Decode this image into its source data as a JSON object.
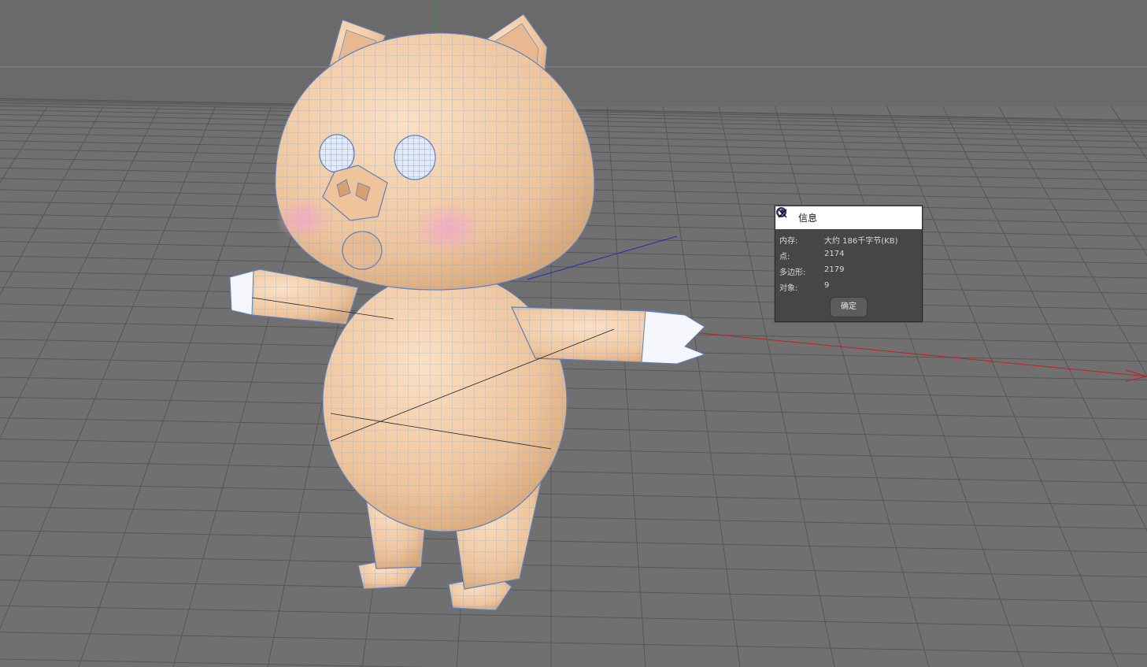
{
  "dialog": {
    "title": "信息",
    "rows": [
      {
        "label": "内存:",
        "value": "大约 186千字节(KB)"
      },
      {
        "label": "点:",
        "value": "2174"
      },
      {
        "label": "多边形:",
        "value": "2179"
      },
      {
        "label": "对象:",
        "value": "9"
      }
    ],
    "ok_label": "确定"
  },
  "scene": {
    "background_color": "#6e6e6e",
    "grid_color": "#4a4a4a",
    "model_color": "#f0c8a0",
    "wire_color": "#7d9fd0",
    "axis_x_color": "#c02020",
    "axis_y_color": "#20a040",
    "axis_z_color": "#2030b0"
  },
  "icons": {
    "app": "cinema4d-icon",
    "close": "close-icon"
  }
}
